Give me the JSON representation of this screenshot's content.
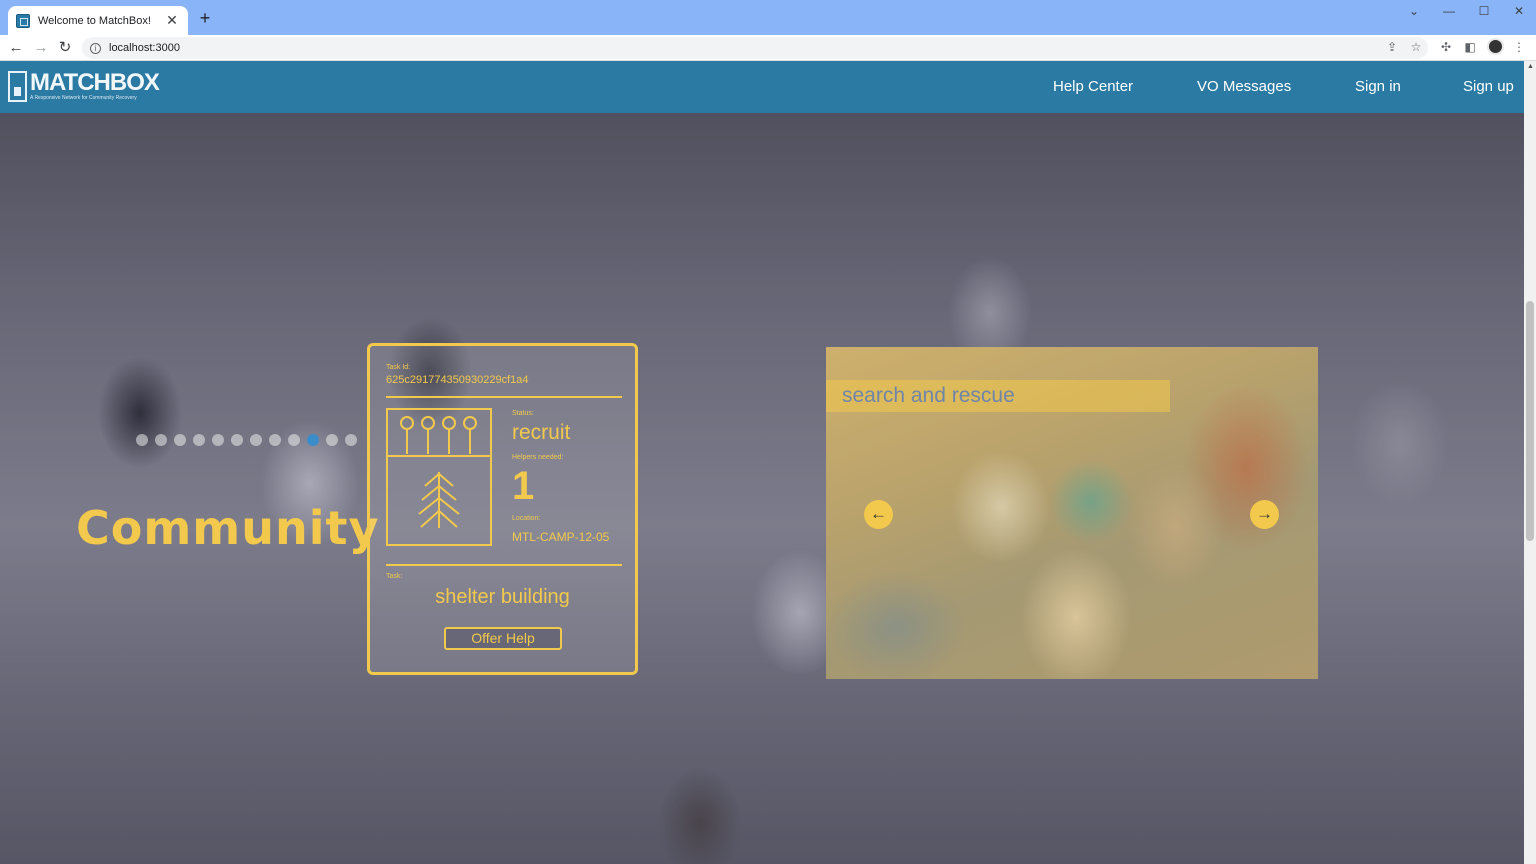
{
  "browser": {
    "tab_title": "Welcome to MatchBox!",
    "close_glyph": "✕",
    "newtab_glyph": "+",
    "url": "localhost:3000",
    "window_controls": [
      "⌄",
      "—",
      "☐",
      "✕"
    ]
  },
  "navbar": {
    "logo_text": "MATCHBOX",
    "logo_tagline": "A Responsive Network for Community Recovery",
    "links": [
      "Help Center",
      "VO Messages",
      "Sign in",
      "Sign up"
    ]
  },
  "hero": {
    "heading": "Community"
  },
  "task_card": {
    "task_id_label": "Task Id:",
    "task_id": "625c291774350930229cf1a4",
    "status_label": "Status:",
    "status": "recruit",
    "helpers_label": "Helpers needed:",
    "helpers": "1",
    "location_label": "Location:",
    "location": "MTL-CAMP-12-05",
    "task_label": "Task:",
    "task": "shelter building",
    "offer_button": "Offer Help"
  },
  "carousel": {
    "caption": "search and rescue",
    "prev_glyph": "←",
    "next_glyph": "→",
    "slide_count": 12,
    "active_slide": 9
  },
  "colors": {
    "accent": "#f2c94c",
    "navbar": "#2b7aa3",
    "active_dot": "#3a8dc9"
  }
}
